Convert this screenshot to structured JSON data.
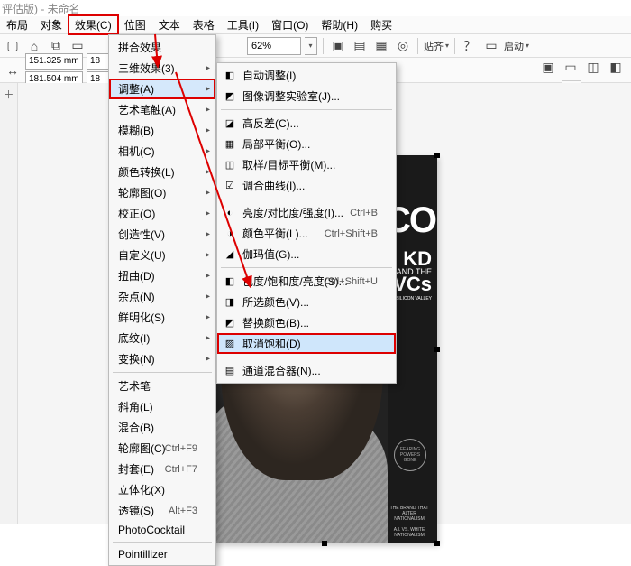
{
  "title_suffix": "评估版) - 未命名",
  "menubar": [
    "布局",
    "对象",
    "效果(C)",
    "位图",
    "文本",
    "表格",
    "工具(I)",
    "窗口(O)",
    "帮助(H)",
    "购买"
  ],
  "menubar_hl_index": 2,
  "toolbar1": {
    "zoom_value": "62%",
    "paste_label": "贴齐",
    "start_label": "启动"
  },
  "toolbar2": {
    "width_label": "151.325 mm",
    "height_label": "181.504 mm",
    "preset_label": "18"
  },
  "menu1": {
    "items": [
      {
        "label": "拼合效果"
      },
      {
        "label": "三维效果(3)",
        "arrow": true
      },
      {
        "label": "调整(A)",
        "arrow": true,
        "hl": true
      },
      {
        "label": "艺术笔触(A)",
        "arrow": true
      },
      {
        "label": "模糊(B)",
        "arrow": true
      },
      {
        "label": "相机(C)",
        "arrow": true
      },
      {
        "label": "颜色转换(L)",
        "arrow": true
      },
      {
        "label": "轮廓图(O)",
        "arrow": true
      },
      {
        "label": "校正(O)",
        "arrow": true
      },
      {
        "label": "创造性(V)",
        "arrow": true
      },
      {
        "label": "自定义(U)",
        "arrow": true
      },
      {
        "label": "扭曲(D)",
        "arrow": true
      },
      {
        "label": "杂点(N)",
        "arrow": true
      },
      {
        "label": "鲜明化(S)",
        "arrow": true
      },
      {
        "label": "底纹(I)",
        "arrow": true
      },
      {
        "label": "变换(N)",
        "arrow": true
      },
      {
        "sep": true
      },
      {
        "label": "艺术笔"
      },
      {
        "label": "斜角(L)"
      },
      {
        "label": "混合(B)"
      },
      {
        "label": "轮廓图(C)",
        "sc": "Ctrl+F9"
      },
      {
        "label": "封套(E)",
        "sc": "Ctrl+F7"
      },
      {
        "label": "立体化(X)"
      },
      {
        "label": "透镜(S)",
        "sc": "Alt+F3"
      },
      {
        "label": "PhotoCocktail"
      },
      {
        "sep": true
      },
      {
        "label": "Pointillizer"
      }
    ]
  },
  "menu2": {
    "items": [
      {
        "label": "自动调整(I)",
        "icon": "◧"
      },
      {
        "label": "图像调整实验室(J)...",
        "icon": "◩"
      },
      {
        "sep": true
      },
      {
        "label": "高反差(C)...",
        "icon": "◪"
      },
      {
        "label": "局部平衡(O)...",
        "icon": "▦"
      },
      {
        "label": "取样/目标平衡(M)...",
        "icon": "◫"
      },
      {
        "label": "调合曲线(I)...",
        "icon": "☑"
      },
      {
        "sep": true
      },
      {
        "label": "亮度/对比度/强度(I)...",
        "sc": "Ctrl+B",
        "icon": "◐"
      },
      {
        "label": "颜色平衡(L)...",
        "sc": "Ctrl+Shift+B",
        "icon": "◑"
      },
      {
        "label": "伽玛值(G)...",
        "icon": "◢"
      },
      {
        "sep": true
      },
      {
        "label": "色度/饱和度/亮度(S)...",
        "sc": "Ctrl+Shift+U",
        "icon": "◧"
      },
      {
        "label": "所选颜色(V)...",
        "icon": "◨"
      },
      {
        "label": "替换颜色(B)...",
        "icon": "◩"
      },
      {
        "label": "取消饱和(D)",
        "icon": "▨",
        "sel": true
      },
      {
        "sep": true
      },
      {
        "label": "通道混合器(N)...",
        "icon": "▤"
      }
    ]
  },
  "cover": {
    "sco": "SCO",
    "kd_top": "KD",
    "kd_and": "AND THE",
    "kd_vcs": "VCs",
    "kd_blurb": "THE INSIDE STORY OF HOW NBA CHAMP DURANT BECAME A SENSATION IN SILICON VALLEY",
    "circle": "FEARING POWERS GONE",
    "footer1": "THE BRAND THAT ALTER NATIONALISM",
    "footer2": "A.I. VS. WHITE NATIONALISM"
  }
}
